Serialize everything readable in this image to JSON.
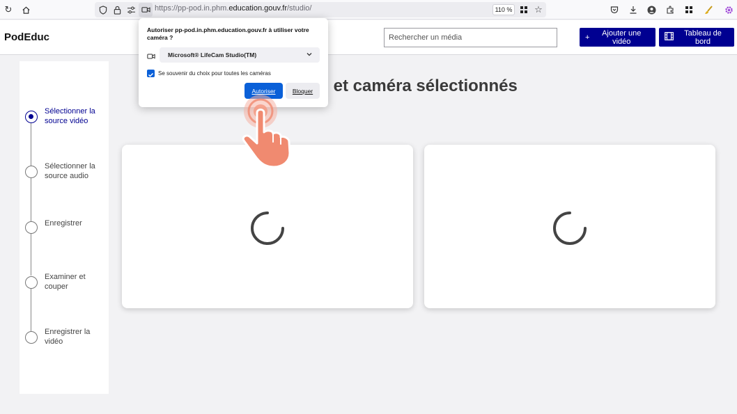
{
  "browser": {
    "url_prefix": "https://pp-pod.in.phm.",
    "url_domain": "education.gouv.fr",
    "url_path": "/studio/",
    "zoom": "110 %"
  },
  "header": {
    "logo": "PodEduc",
    "search_placeholder": "Rechercher un média",
    "add_video_label": "Ajouter une vidéo",
    "dashboard_label": "Tableau de bord"
  },
  "stepper": {
    "steps": [
      {
        "label": "Sélectionner la source vidéo",
        "active": true
      },
      {
        "label": "Sélectionner la source audio",
        "active": false
      },
      {
        "label": "Enregistrer",
        "active": false
      },
      {
        "label": "Examiner et couper",
        "active": false
      },
      {
        "label": "Enregistrer la vidéo",
        "active": false
      }
    ]
  },
  "main": {
    "heading": "an et caméra sélectionnés"
  },
  "permission": {
    "title": "Autoriser pp-pod.in.phm.education.gouv.fr à utiliser votre caméra ?",
    "camera": "Microsoft® LifeCam Studio(TM)",
    "remember": "Se souvenir du choix pour toutes les caméras",
    "allow": "Autoriser",
    "block": "Bloquer"
  },
  "colors": {
    "primary": "#000091",
    "allow_button": "#0a60d8",
    "hand": "#f08a70"
  }
}
